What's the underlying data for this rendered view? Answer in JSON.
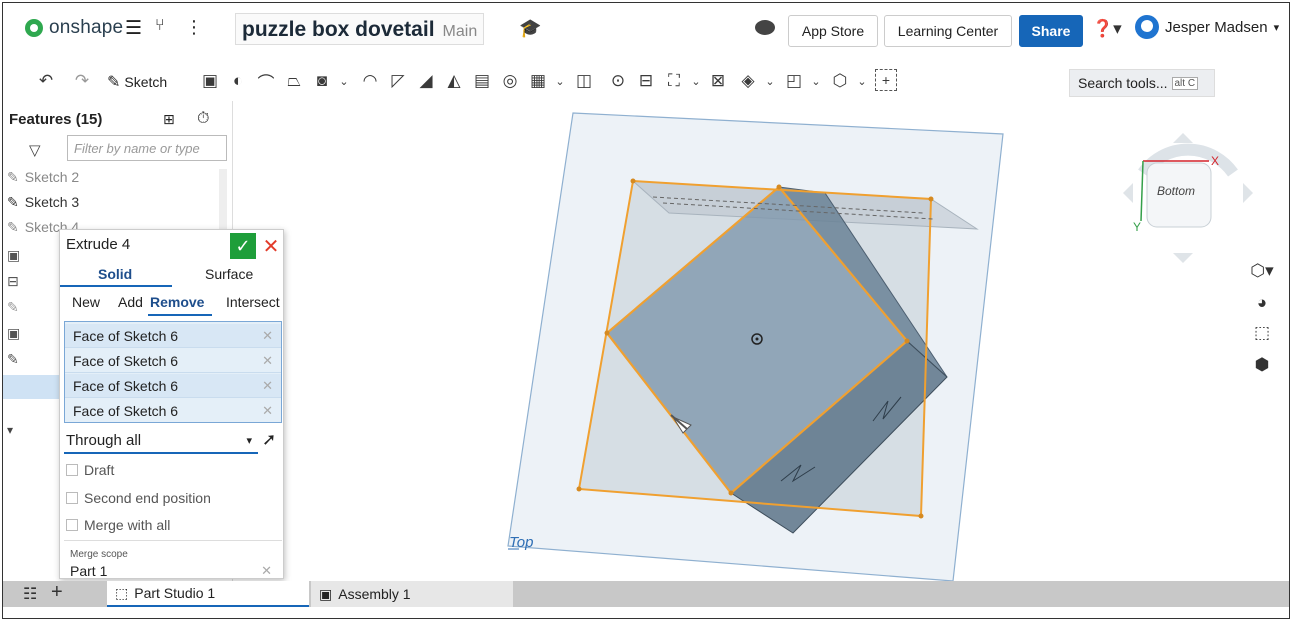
{
  "topbar": {
    "logo_text": "onshape",
    "doc_name": "puzzle box dovetail",
    "branch": "Main",
    "app_store": "App Store",
    "learning_center": "Learning Center",
    "share": "Share",
    "user_name": "Jesper Madsen"
  },
  "toolbar": {
    "sketch_label": "Sketch",
    "search_placeholder": "Search tools...",
    "search_shortcut": "alt C"
  },
  "features": {
    "header": "Features (15)",
    "filter_placeholder": "Filter by name or type",
    "items": [
      "Sketch 2",
      "Sketch 3",
      "Sketch 4"
    ]
  },
  "dialog": {
    "title": "Extrude 4",
    "tabs": [
      "Solid",
      "Surface"
    ],
    "operations": [
      "New",
      "Add",
      "Remove",
      "Intersect"
    ],
    "active_operation": "Remove",
    "faces": [
      "Face of Sketch 6",
      "Face of Sketch 6",
      "Face of Sketch 6",
      "Face of Sketch 6"
    ],
    "end_type": "Through all",
    "options": [
      "Draft",
      "Second end position",
      "Merge with all"
    ],
    "merge_scope_label": "Merge scope",
    "merge_scope_value": "Part 1"
  },
  "viewport": {
    "plane_label": "Top",
    "view_cube_face": "Bottom",
    "axis_x": "X",
    "axis_y": "Y"
  },
  "tabs": {
    "part_studio": "Part Studio 1",
    "assembly": "Assembly 1"
  },
  "colors": {
    "accent": "#1666b8",
    "selection": "#f0a030",
    "ok": "#1e9e3a",
    "cancel": "#e23b2a"
  }
}
